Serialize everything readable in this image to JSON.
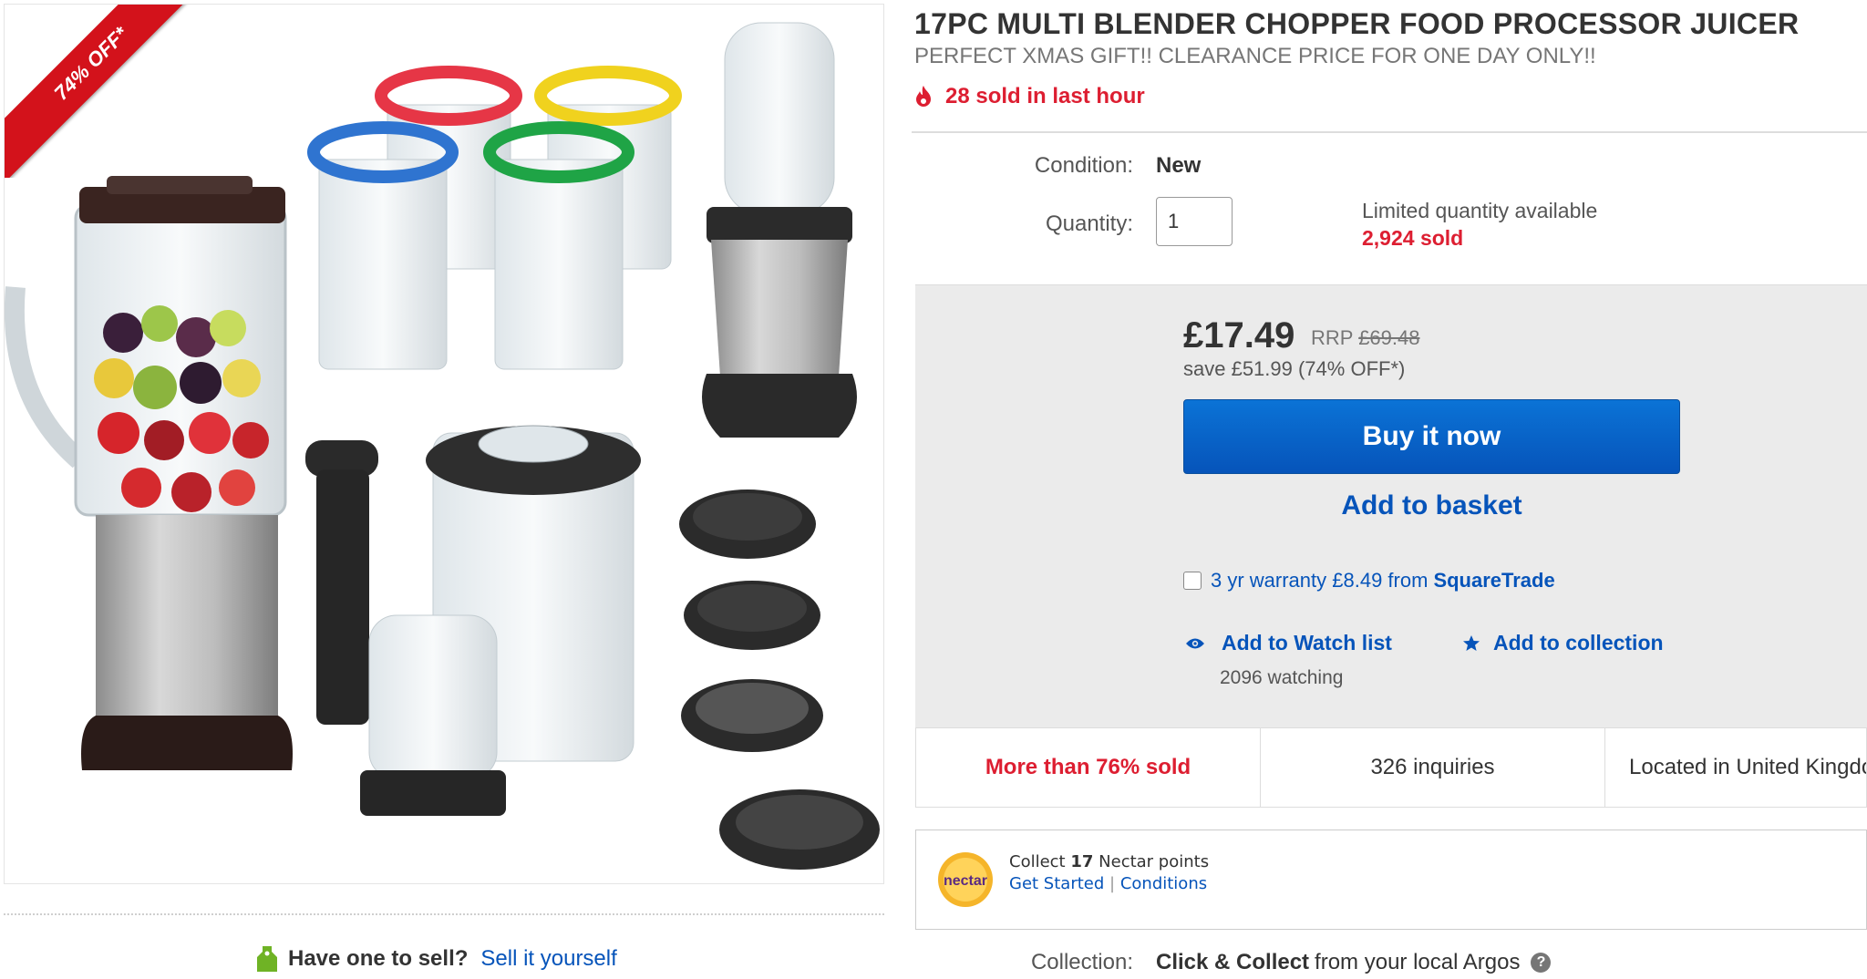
{
  "gallery": {
    "badge": "74% OFF*"
  },
  "sell": {
    "question": "Have one to sell?",
    "link": "Sell it yourself"
  },
  "listing": {
    "title": "17PC MULTI BLENDER CHOPPER FOOD PROCESSOR JUICER",
    "subtitle": "PERFECT XMAS GIFT!! CLEARANCE PRICE FOR ONE DAY ONLY!!",
    "hot_text": "28 sold in last hour"
  },
  "details": {
    "condition_label": "Condition:",
    "condition_value": "New",
    "quantity_label": "Quantity:",
    "quantity_value": "1",
    "availability": "Limited quantity available",
    "sold_count": "2,924 sold"
  },
  "pricing": {
    "price": "£17.49",
    "rrp_label": "RRP",
    "rrp_value": "£69.48",
    "save_text": "save £51.99 (74% OFF*)"
  },
  "actions": {
    "buy_now": "Buy it now",
    "add_to_basket": "Add to basket",
    "warranty_text": "3 yr warranty £8.49 from",
    "warranty_brand": "SquareTrade",
    "watch_list": "Add to Watch list",
    "add_collection": "Add to collection",
    "watching": "2096 watching"
  },
  "stats": {
    "sold_pct": "More than 76% sold",
    "inquiries": "326 inquiries",
    "location": "Located in United Kingdom"
  },
  "nectar": {
    "logo": "nectar",
    "collect_prefix": "Collect",
    "points": "17",
    "collect_suffix": "Nectar points",
    "get_started": "Get Started",
    "separator": "|",
    "conditions": "Conditions"
  },
  "collection": {
    "label": "Collection:",
    "method": "Click & Collect",
    "suffix": "from your local Argos",
    "help": "?"
  },
  "colors": {
    "accent_blue": "#0654ba",
    "alert_red": "#dd1e31",
    "ribbon_red": "#d3121b",
    "panel_grey": "#ebebeb"
  },
  "icons": {
    "hot": "flame-icon",
    "watch": "eye-icon",
    "collection": "star-icon",
    "sell": "price-tag-icon",
    "help": "question-circle-icon"
  }
}
